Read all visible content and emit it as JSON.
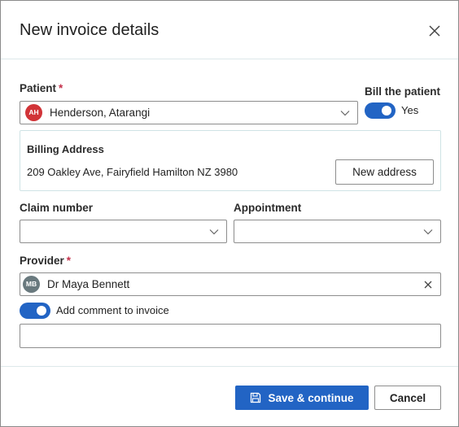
{
  "dialog": {
    "title": "New invoice details"
  },
  "patient": {
    "label": "Patient",
    "required_mark": "*",
    "avatar_initials": "AH",
    "avatar_color": "#d13438",
    "value": "Henderson, Atarangi"
  },
  "bill_patient": {
    "label": "Bill the patient",
    "toggle_on": true,
    "state_text": "Yes"
  },
  "billing": {
    "heading": "Billing Address",
    "address": "209 Oakley Ave, Fairyfield Hamilton NZ 3980",
    "new_address_button": "New address"
  },
  "claim": {
    "label": "Claim number",
    "value": ""
  },
  "appointment": {
    "label": "Appointment",
    "value": ""
  },
  "provider": {
    "label": "Provider",
    "required_mark": "*",
    "avatar_initials": "MB",
    "avatar_color": "#69797e",
    "value": "Dr Maya Bennett"
  },
  "comment": {
    "toggle_on": true,
    "label": "Add comment to invoice",
    "value": ""
  },
  "footer": {
    "save_label": "Save & continue",
    "cancel_label": "Cancel"
  },
  "colors": {
    "accent": "#2264c4",
    "border": "#8d8d8d",
    "divider": "#dde8ea",
    "required": "#c4314b"
  },
  "icons": {
    "close": "close-icon",
    "dropdown": "chevron-down-icon",
    "clear": "clear-icon",
    "save": "save-icon"
  }
}
